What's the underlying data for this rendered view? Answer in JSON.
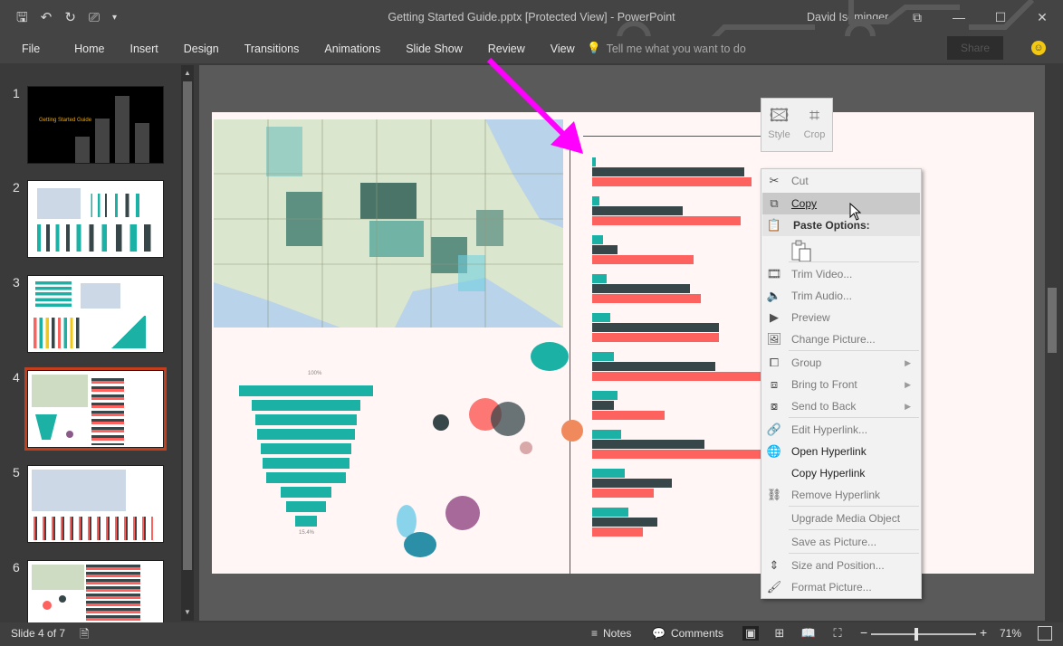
{
  "window": {
    "title": "Getting Started Guide.pptx [Protected View] - PowerPoint",
    "user": "David Iseminger",
    "controls": [
      "restore-ribbon",
      "minimize",
      "maximize",
      "close"
    ]
  },
  "ribbon": {
    "tabs": [
      "File",
      "Home",
      "Insert",
      "Design",
      "Transitions",
      "Animations",
      "Slide Show",
      "Review",
      "View"
    ],
    "tell_me": "Tell me what you want to do",
    "share": "Share"
  },
  "slides": {
    "numbers": [
      "1",
      "2",
      "3",
      "4",
      "5",
      "6"
    ],
    "selected": "4",
    "slide1_title": "Getting Started Guide"
  },
  "mini_toolbar": {
    "style": "Style",
    "crop": "Crop"
  },
  "context_menu": {
    "cut": "Cut",
    "copy": "Copy",
    "paste_options": "Paste Options:",
    "trim_video": "Trim Video...",
    "trim_audio": "Trim Audio...",
    "preview": "Preview",
    "change_picture": "Change Picture...",
    "group": "Group",
    "bring_to_front": "Bring to Front",
    "send_to_back": "Send to Back",
    "edit_hyperlink": "Edit Hyperlink...",
    "open_hyperlink": "Open Hyperlink",
    "copy_hyperlink": "Copy Hyperlink",
    "remove_hyperlink": "Remove Hyperlink",
    "upgrade_media": "Upgrade Media Object",
    "save_as_picture": "Save as Picture...",
    "size_position": "Size and Position...",
    "format_picture": "Format Picture..."
  },
  "slide_content": {
    "funnel_top_label": "100%",
    "funnel_bottom_label": "15.4%",
    "bar_colors": {
      "teal": "#1bb1a5",
      "dark": "#374649",
      "red": "#fd625e"
    },
    "bar_rows": [
      {
        "teal": 1,
        "dark": 42,
        "red": 44
      },
      {
        "teal": 2,
        "dark": 25,
        "red": 41
      },
      {
        "teal": 3,
        "dark": 7,
        "red": 28
      },
      {
        "teal": 4,
        "dark": 27,
        "red": 30
      },
      {
        "teal": 5,
        "dark": 35,
        "red": 35
      },
      {
        "teal": 6,
        "dark": 34,
        "red": 50
      },
      {
        "teal": 7,
        "dark": 6,
        "red": 20
      },
      {
        "teal": 8,
        "dark": 31,
        "red": 50
      },
      {
        "teal": 9,
        "dark": 22,
        "red": 17
      },
      {
        "teal": 10,
        "dark": 18,
        "red": 14
      }
    ]
  },
  "status": {
    "slide_info": "Slide 4 of 7",
    "notes": "Notes",
    "comments": "Comments",
    "zoom": "71%"
  },
  "colors": {
    "accent_selected": "#c43e1c",
    "arrow": "#ff00ff"
  }
}
